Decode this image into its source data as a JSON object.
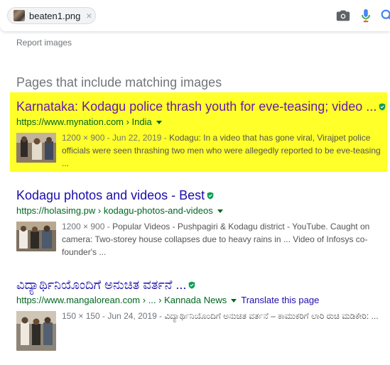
{
  "searchbar": {
    "chip_label": "beaten1.png",
    "chip_close": "×",
    "icons": [
      "camera-icon",
      "microphone-icon",
      "search-icon"
    ]
  },
  "report_images": "Report images",
  "section_heading": "Pages that include matching images",
  "colors": {
    "link": "#1a0dab",
    "url": "#006621",
    "highlight": "#ffff29",
    "verified": "#0f9d58"
  },
  "results": [
    {
      "title": "Karnataka: Kodagu police thrash youth for eve-teasing; video ...",
      "title_color": "#681da8",
      "url": "https://www.mynation.com › India",
      "meta": "1200 × 900 - Jun 22, 2019 -",
      "snippet": "Kodagu: In a video that has gone viral, Virajpet police officials were seen thrashing two men who were allegedly reported to be eve-teasing ..."
    },
    {
      "title": "Kodagu photos and videos - Best",
      "title_color": "#1a0dab",
      "url": "https://holasimg.pw › kodagu-photos-and-videos",
      "meta": "1200 × 900 -",
      "snippet": "Popular Videos - Pushpagiri & Kodagu district - YouTube. Caught on camera: Two-storey house collapses due to heavy rains in ... Video of Infosys co-founder's ..."
    },
    {
      "title": "ವಿದ್ಯಾರ್ಥಿನಿಯೊಂದಿಗೆ ಅನುಚಿತ ವರ್ತನೆ ...",
      "title_color": "#1a0dab",
      "url": "https://www.mangalorean.com › ... › Kannada News",
      "translate": "Translate this page",
      "meta": "150 × 150 - Jun 24, 2019 -",
      "snippet": "ವಿದ್ಯಾರ್ಥಿನಿಯೊಂದಿಗೆ ಅನುಚಿತ ವರ್ತನೆ – ಕಾಮುಕರಿಗೆ ಲಾರಿ ರುಚಿ ಮಡಿಕೇರಿ: ..."
    }
  ]
}
